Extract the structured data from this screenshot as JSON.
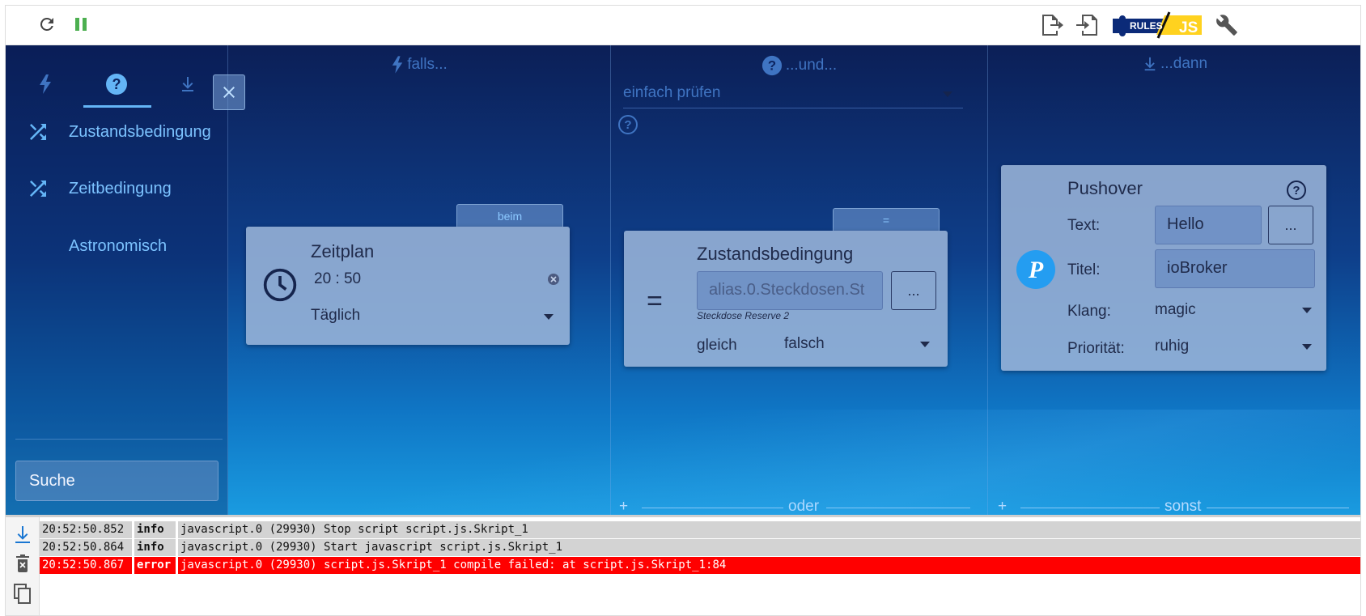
{
  "toolbar": {
    "reload_icon": "reload-icon",
    "pause_icon": "pause-icon",
    "export_icon": "export-icon",
    "import_icon": "import-icon",
    "logo_text_rules": "RULES",
    "logo_text_js": "JS",
    "settings_icon": "wrench-icon",
    "colors": {
      "pause": "#4caf50",
      "logo_dark": "#0b2a78",
      "logo_yellow": "#ffd21f"
    }
  },
  "sidebar": {
    "tabs": [
      {
        "icon": "lightning-icon"
      },
      {
        "icon": "question-icon",
        "active": true
      },
      {
        "icon": "download-icon"
      }
    ],
    "items": [
      {
        "label": "Zustandsbedingung",
        "icon": "shuffle-icon"
      },
      {
        "label": "Zeitbedingung",
        "icon": "shuffle-icon"
      },
      {
        "label": "Astronomisch",
        "icon": "moon-icon"
      }
    ],
    "search_placeholder": "Suche"
  },
  "columns": {
    "falls": {
      "header": "falls...",
      "tab_label": "beim",
      "card": {
        "title": "Zeitplan",
        "time": "20 : 50",
        "select": "Täglich"
      }
    },
    "und": {
      "header": "...und...",
      "select": "einfach prüfen",
      "tab_label": "=",
      "card": {
        "title": "Zustandsbedingung",
        "symbol": "=",
        "field_value": "alias.0.Steckdosen.St",
        "caption": "Steckdose Reserve 2",
        "dots": "...",
        "compare_label": "gleich",
        "compare_value": "falsch"
      },
      "footer": "oder",
      "add": "+"
    },
    "dann": {
      "header": "...dann",
      "card": {
        "title": "Pushover",
        "logo_letter": "P",
        "text_label": "Text:",
        "text_value": "Hello",
        "dots": "...",
        "title_label": "Titel:",
        "title_value": "ioBroker",
        "sound_label": "Klang:",
        "sound_value": "magic",
        "priority_label": "Priorität:",
        "priority_value": "ruhig"
      },
      "footer": "sonst",
      "add": "+"
    }
  },
  "log": {
    "rows": [
      {
        "time": "20:52:50.852",
        "severity": "info",
        "message": "javascript.0 (29930) Stop script script.js.Skript_1"
      },
      {
        "time": "20:52:50.864",
        "severity": "info",
        "message": "javascript.0 (29930) Start javascript script.js.Skript_1"
      },
      {
        "time": "20:52:50.867",
        "severity": "error",
        "message": "javascript.0 (29930) script.js.Skript_1 compile failed: at script.js.Skript_1:84"
      }
    ]
  }
}
